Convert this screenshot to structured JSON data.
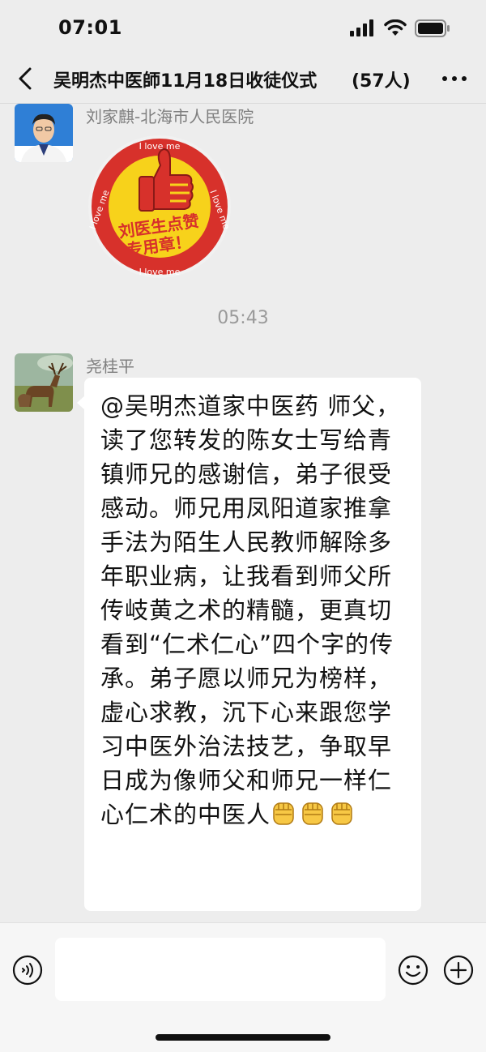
{
  "status_bar": {
    "time": "07:01"
  },
  "header": {
    "title": "吴明杰中医師11月18日收徒仪式",
    "member_count": "(57人)"
  },
  "messages": [
    {
      "sender": "刘家麒-北海市人民医院",
      "sticker": {
        "ring_text": "I love me",
        "label_line1": "刘医生点赞",
        "label_line2": "专用章！"
      }
    },
    {
      "sender": "尧桂平",
      "text": "@吴明杰道家中医药 师父，读了您转发的陈女士写给青镇师兄的感谢信，弟子很受感动。师兄用凤阳道家推拿手法为陌生人民教师解除多年职业病，让我看到师父所传岐黄之术的精髓，更真切看到“仁术仁心”四个字的传承。弟子愿以师兄为榜样，虚心求教，沉下心来跟您学习中医外治法技艺，争取早日成为像师父和师兄一样仁心仁术的中医人",
      "emojis": [
        "fist",
        "fist",
        "fist"
      ]
    }
  ],
  "timestamp": "05:43",
  "input": {
    "placeholder": ""
  },
  "colors": {
    "background": "#ededed",
    "bubble": "#ffffff",
    "sticker_red": "#d7312b",
    "sticker_yellow": "#f7d21b",
    "sender_gray": "#7f7f7f"
  }
}
